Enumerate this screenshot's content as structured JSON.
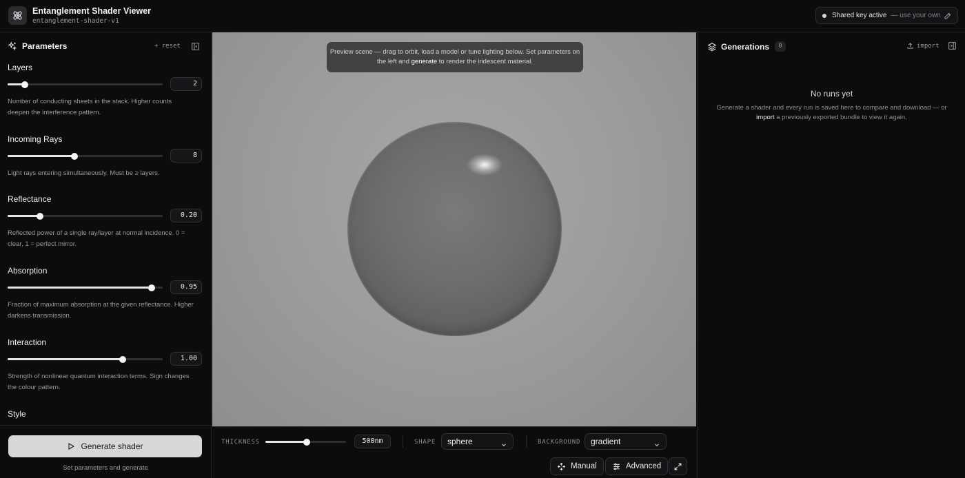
{
  "app": {
    "title": "Entanglement Shader Viewer",
    "subtitle": "entanglement-shader-v1"
  },
  "key": {
    "status": "Shared key active",
    "hint": "— use your own"
  },
  "parameters": {
    "title": "Parameters",
    "reset_label": "+ reset",
    "items": [
      {
        "label": "Layers",
        "value": "2",
        "fill": 0.11,
        "desc": "Number of conducting sheets in the stack. Higher counts deepen the interference pattern."
      },
      {
        "label": "Incoming Rays",
        "value": "8",
        "fill": 0.43,
        "desc": "Light rays entering simultaneously. Must be ≥ layers."
      },
      {
        "label": "Reflectance",
        "value": "0.20",
        "fill": 0.21,
        "desc": "Reflected power of a single ray/layer at normal incidence. 0 = clear, 1 = perfect mirror."
      },
      {
        "label": "Absorption",
        "value": "0.95",
        "fill": 0.93,
        "desc": "Fraction of maximum absorption at the given reflectance. Higher darkens transmission."
      },
      {
        "label": "Interaction",
        "value": "1.00",
        "fill": 0.74,
        "desc": "Strength of nonlinear quantum interaction terms. Sign changes the colour pattern."
      },
      {
        "label": "Style",
        "value": "",
        "fill": 0,
        "desc": ""
      }
    ],
    "generate_label": "Generate shader",
    "generate_hint": "Set parameters and generate"
  },
  "viewport": {
    "tooltip_a": "Preview scene — drag to orbit, load a model or tune lighting below. Set parameters on the left and ",
    "tooltip_b": "generate",
    "tooltip_c": " to render the iridescent material."
  },
  "controls": {
    "thickness_label": "THICKNESS",
    "thickness_value": "500nm",
    "thickness_fill": 0.51,
    "shape_label": "SHAPE",
    "shape_value": "sphere",
    "background_label": "BACKGROUND",
    "background_value": "gradient",
    "manual_label": "Manual",
    "advanced_label": "Advanced"
  },
  "generations": {
    "title": "Generations",
    "count": "0",
    "import_label": "import",
    "empty_title": "No runs yet",
    "empty_desc_a": "Generate a shader and every run is saved here to compare and download — or ",
    "empty_desc_b": "import",
    "empty_desc_c": " a previously exported bundle to view it again."
  },
  "icons": [
    "atom-icon",
    "edit-icon",
    "sparkles-icon",
    "panel-collapse-icon",
    "play-icon",
    "layers-icon",
    "upload-icon",
    "chevron-down-icon",
    "orbit-icon",
    "sliders-icon",
    "expand-icon"
  ]
}
